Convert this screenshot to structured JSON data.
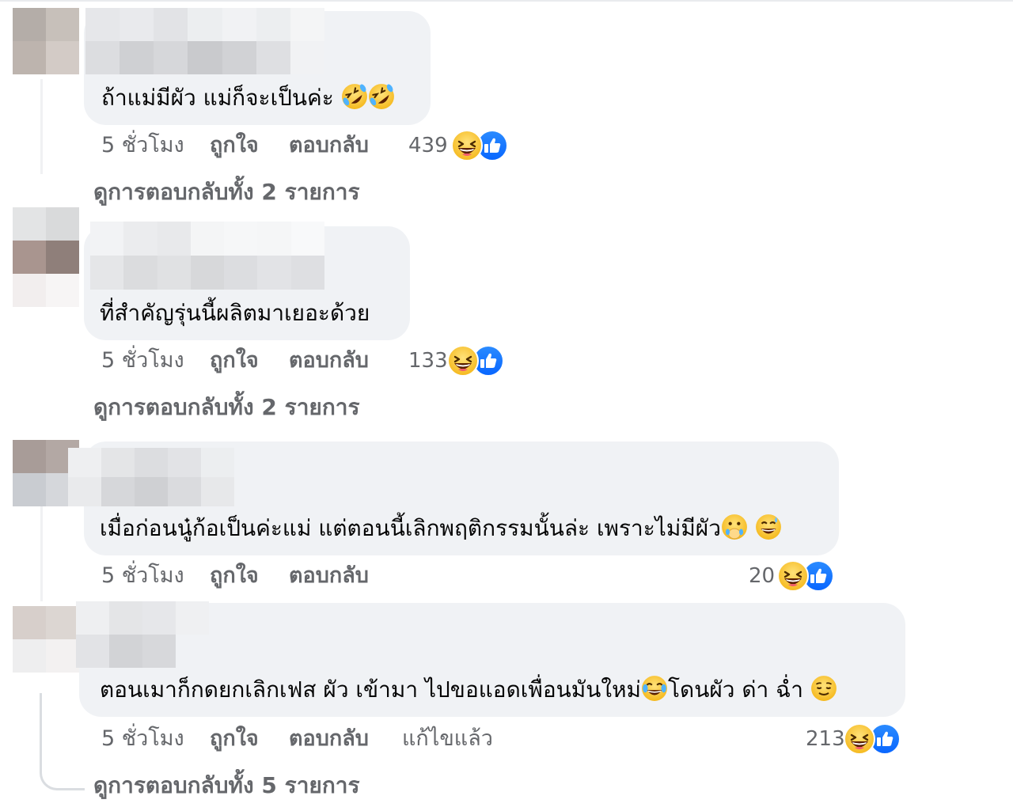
{
  "comments": [
    {
      "text": "ถ้าแม่มีผัว แม่ก็จะเป็นค่ะ",
      "time": "5 ชั่วโมง",
      "like": "ถูกใจ",
      "reply": "ตอบกลับ",
      "reaction_count": "439",
      "view_replies": "ดูการตอบกลับทั้ง 2 รายการ"
    },
    {
      "text": "ที่สำคัญรุ่นนี้ผลิตมาเยอะด้วย",
      "time": "5 ชั่วโมง",
      "like": "ถูกใจ",
      "reply": "ตอบกลับ",
      "reaction_count": "133",
      "view_replies": "ดูการตอบกลับทั้ง 2 รายการ"
    },
    {
      "text": "เมื่อก่อนนู๋ก้อเป็นค่ะแม่ แต่ตอนนี้เลิกพฤติกรรมนั้นล่ะ เพราะไม่มีผัว",
      "time": "5 ชั่วโมง",
      "like": "ถูกใจ",
      "reply": "ตอบกลับ",
      "reaction_count": "20"
    },
    {
      "text_part1": "ตอนเมาก็กดยกเลิกเฟส ผัว เข้ามา ไปขอแอดเพื่อนมันใหม่",
      "text_part2": "โดนผัว ด่า ฉ่ำ",
      "time": "5 ชั่วโมง",
      "like": "ถูกใจ",
      "reply": "ตอบกลับ",
      "edited": "แก้ไขแล้ว",
      "reaction_count": "213",
      "view_replies": "ดูการตอบกลับทั้ง 5 รายการ"
    }
  ],
  "icons": {
    "rolling_laugh": "rolling-on-floor-laughing-emoji",
    "grin": "grinning-squinting-face-emoji",
    "like": "thumbs-up-icon",
    "hand_over_mouth": "face-with-hand-over-mouth-emoji",
    "sweat_smile": "grinning-face-with-sweat-emoji",
    "tears_joy": "face-with-tears-of-joy-emoji",
    "relieved": "relieved-face-emoji"
  },
  "colors": {
    "bubble": "#f0f2f5",
    "meta_text": "#65676b",
    "like_blue": "#1877f2",
    "emoji_yellow": "#ffcc33"
  }
}
